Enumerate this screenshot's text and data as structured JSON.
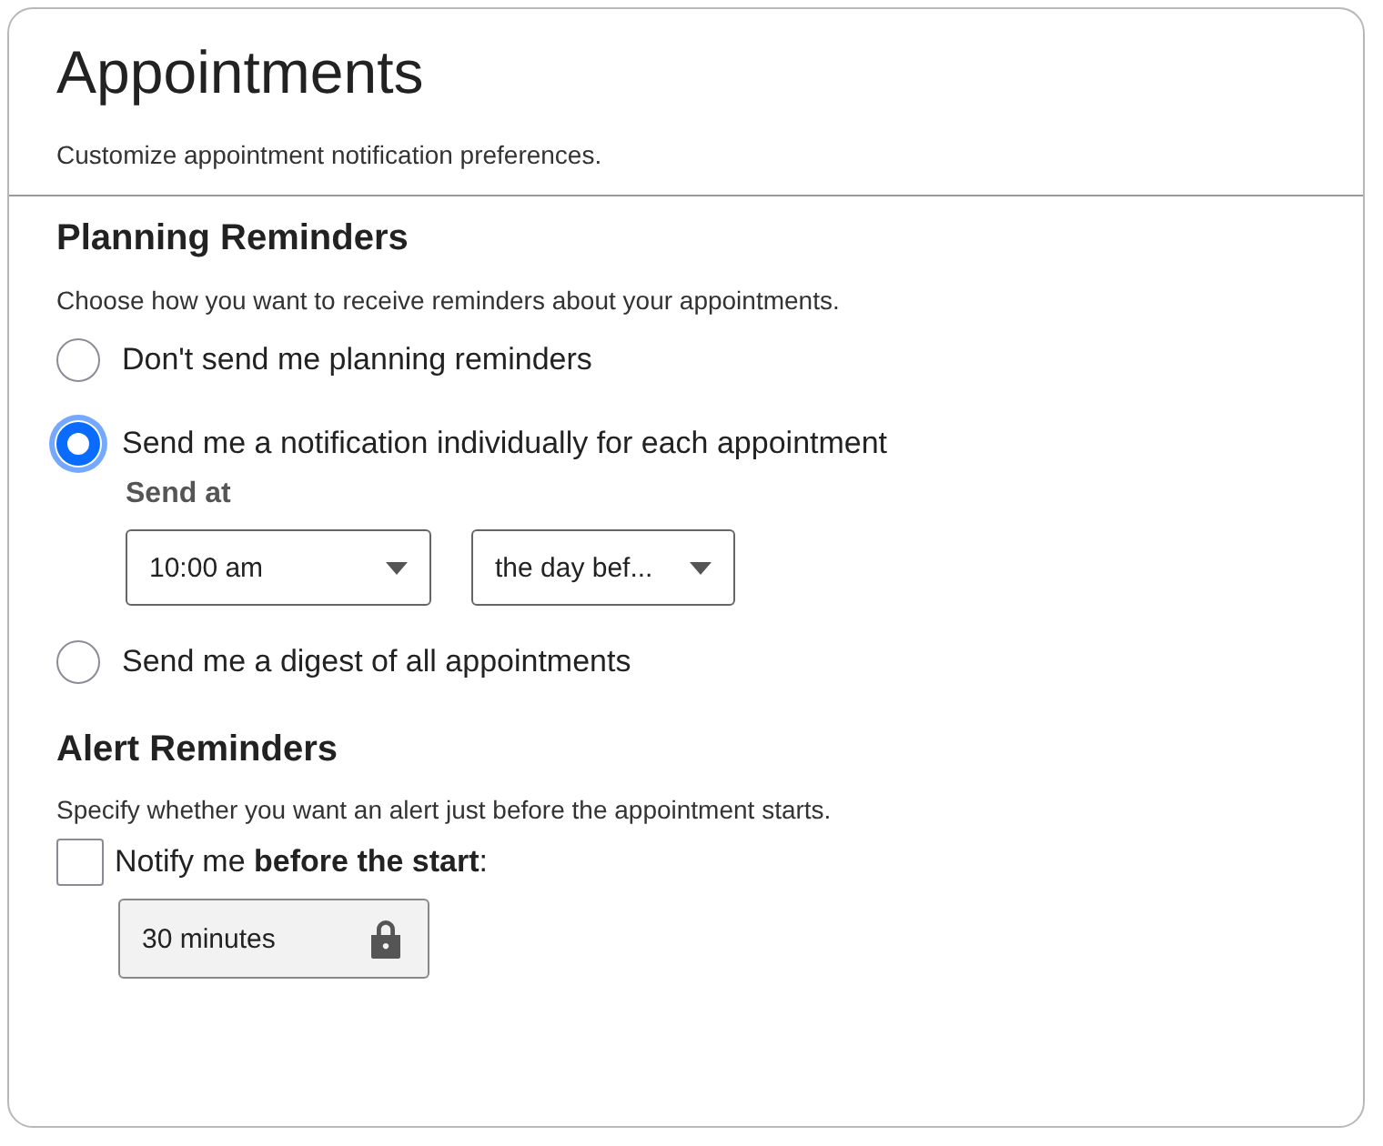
{
  "header": {
    "title": "Appointments",
    "subtitle": "Customize appointment notification preferences."
  },
  "planning": {
    "heading": "Planning Reminders",
    "description": "Choose how you want to receive reminders about your appointments.",
    "options": [
      {
        "label": "Don't send me planning reminders",
        "selected": false
      },
      {
        "label": "Send me a notification individually for each appointment",
        "selected": true,
        "send_at": {
          "label": "Send at",
          "selects": [
            {
              "value": "10:00 am"
            },
            {
              "value": "the day bef..."
            }
          ]
        }
      },
      {
        "label": "Send me a digest of all appointments",
        "selected": false
      }
    ]
  },
  "alert": {
    "heading": "Alert Reminders",
    "description": "Specify whether you want an alert just before the appointment starts.",
    "checkbox": {
      "label": "Notify me **before the start**:",
      "checked": false
    },
    "duration": {
      "value": "30 minutes",
      "locked": true
    }
  }
}
